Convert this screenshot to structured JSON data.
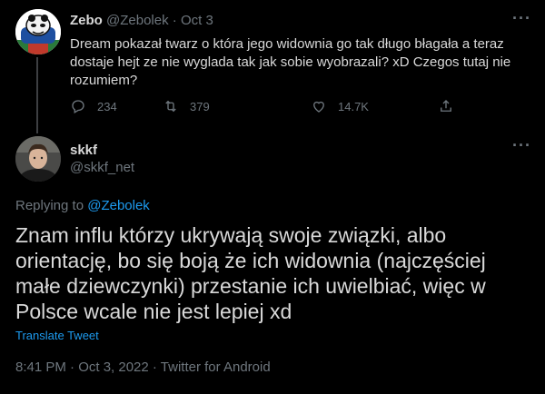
{
  "parent_tweet": {
    "author_name": "Zebo",
    "author_handle": "@Zebolek",
    "separator": "·",
    "date": "Oct 3",
    "text": "Dream pokazał twarz o która jego widownia go tak długo błagała a teraz dostaje hejt ze nie wyglada tak jak sobie wyobrazali? xD Czegos tutaj nie rozumiem?",
    "actions": {
      "reply_count": "234",
      "retweet_count": "379",
      "like_count": "14.7K"
    }
  },
  "main_tweet": {
    "author_name": "skkf",
    "author_handle": "@skkf_net",
    "replying_prefix": "Replying to ",
    "replying_mention": "@Zebolek",
    "text": "Znam influ którzy ukrywają swoje związki, albo orientację, bo się boją że ich widownia (najczęściej małe dziewczynki) przestanie ich uwielbiać, więc w Polsce wcale nie jest lepiej xd",
    "translate_label": "Translate Tweet",
    "meta": "8:41 PM · Oct 3, 2022 · Twitter for Android"
  },
  "colors": {
    "background": "#000000",
    "text": "#d9d9d9",
    "secondary": "#6e767d",
    "link": "#1d9bf0"
  },
  "icons": [
    "reply-icon",
    "retweet-icon",
    "like-icon",
    "share-icon",
    "more-icon"
  ]
}
